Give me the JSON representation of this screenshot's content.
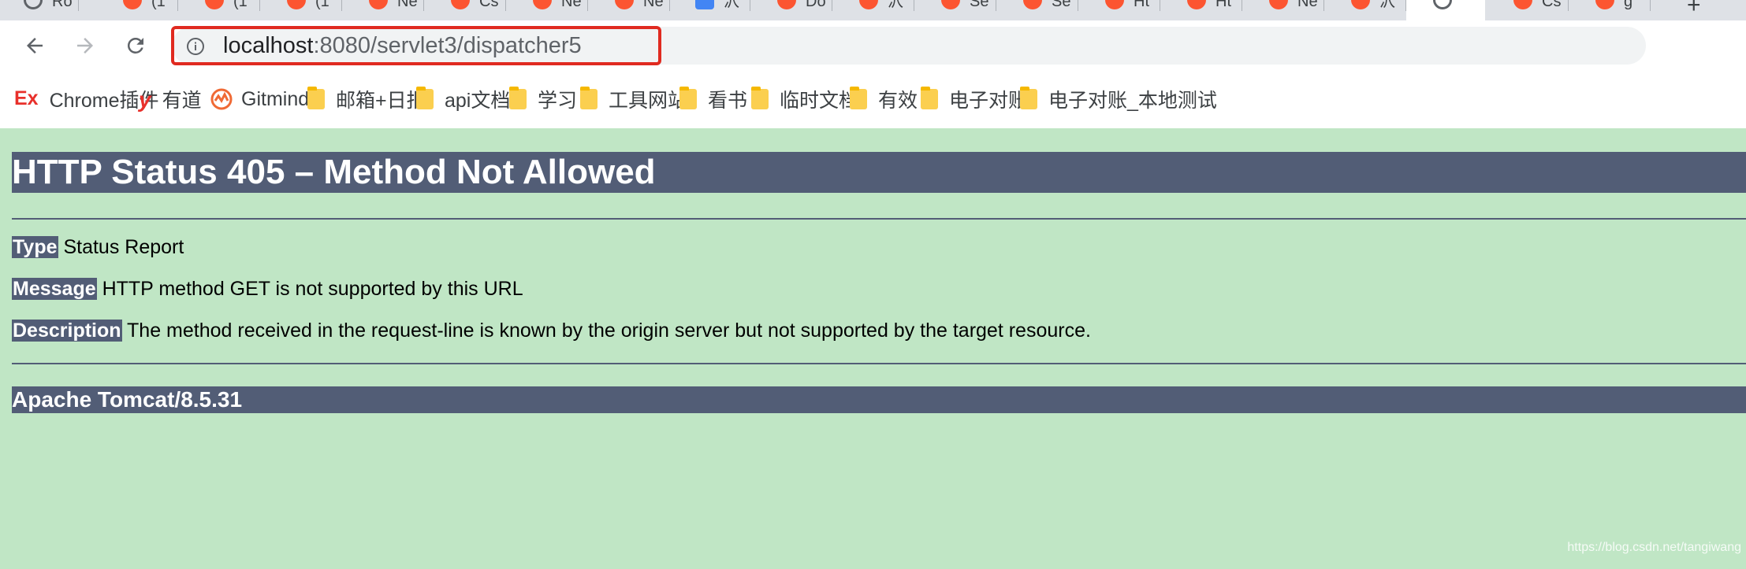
{
  "browser": {
    "tabs": [
      {
        "favicon": "loading-icon",
        "text": "Ro"
      },
      {
        "favicon": "csdn-icon",
        "text": "(1"
      },
      {
        "favicon": "csdn-icon",
        "text": "(1"
      },
      {
        "favicon": "csdn-icon",
        "text": "(1"
      },
      {
        "favicon": "csdn-icon",
        "text": "Ne"
      },
      {
        "favicon": "csdn-icon",
        "text": "Cs"
      },
      {
        "favicon": "csdn-icon",
        "text": "Ne"
      },
      {
        "favicon": "csdn-icon",
        "text": "Ne"
      },
      {
        "favicon": "baidu-icon",
        "text": "沢"
      },
      {
        "favicon": "csdn-icon",
        "text": "Do"
      },
      {
        "favicon": "csdn-icon",
        "text": "沢"
      },
      {
        "favicon": "csdn-icon",
        "text": "Se"
      },
      {
        "favicon": "csdn-icon",
        "text": "Se"
      },
      {
        "favicon": "csdn-icon",
        "text": "Ht"
      },
      {
        "favicon": "csdn-icon",
        "text": "Ht"
      },
      {
        "favicon": "csdn-icon",
        "text": "Ne"
      },
      {
        "favicon": "csdn-icon",
        "text": "沢"
      },
      {
        "favicon": "loading-icon",
        "text": ""
      },
      {
        "favicon": "csdn-icon",
        "text": "Cs"
      },
      {
        "favicon": "csdn-icon",
        "text": "g"
      }
    ],
    "active_tab_index": 17,
    "new_tab_label": "+",
    "url_host": "localhost",
    "url_rest": ":8080/servlet3/dispatcher5",
    "bookmarks": [
      {
        "icon": "ex-logo-icon",
        "label": "Chrome插件"
      },
      {
        "icon": "youdao-icon",
        "label": "有道"
      },
      {
        "icon": "gitmind-icon",
        "label": "Gitmind"
      },
      {
        "icon": "folder-icon",
        "label": "邮箱+日报"
      },
      {
        "icon": "folder-icon",
        "label": "api文档"
      },
      {
        "icon": "folder-icon",
        "label": "学习"
      },
      {
        "icon": "folder-icon",
        "label": "工具网站"
      },
      {
        "icon": "folder-icon",
        "label": "看书"
      },
      {
        "icon": "folder-icon",
        "label": "临时文档"
      },
      {
        "icon": "folder-icon",
        "label": "有效"
      },
      {
        "icon": "folder-icon",
        "label": "电子对账"
      },
      {
        "icon": "folder-icon",
        "label": "电子对账_本地测试"
      }
    ]
  },
  "page": {
    "title": "HTTP Status 405 – Method Not Allowed",
    "type_label": "Type",
    "type_value": "Status Report",
    "message_label": "Message",
    "message_value": "HTTP method GET is not supported by this URL",
    "description_label": "Description",
    "description_value": "The method received in the request-line is known by the origin server but not supported by the target resource.",
    "footer": "Apache Tomcat/8.5.31"
  },
  "watermark": "https://blog.csdn.net/tangiwang",
  "colors": {
    "page_bg": "#c0e6c5",
    "header_bar": "#525d76",
    "csdn_red": "#fc5531",
    "url_highlight": "#e02a20"
  }
}
